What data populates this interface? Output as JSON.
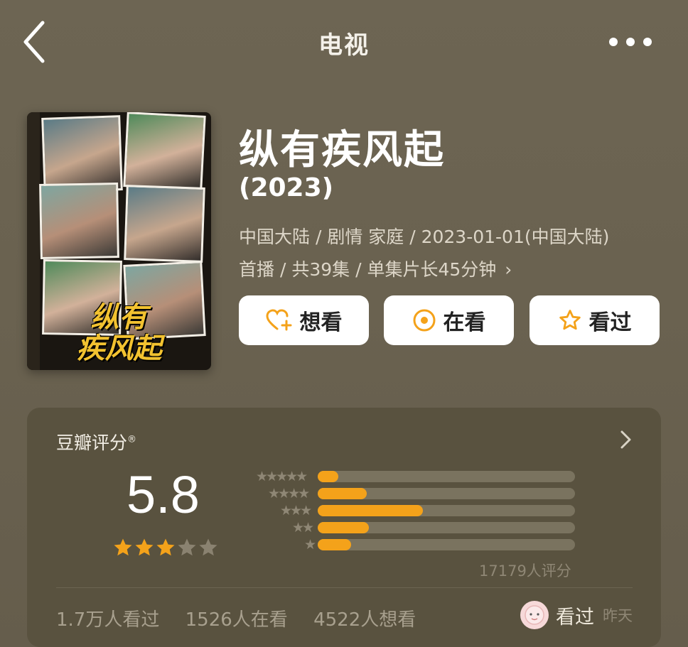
{
  "header": {
    "title": "电视",
    "back_icon": "chevron-left-icon",
    "more_icon": "more-dots-icon"
  },
  "poster": {
    "title_line1": "纵有",
    "title_line2": "疾风起"
  },
  "show": {
    "title": "纵有疾风起",
    "year": "(2023)",
    "meta_line1": "中国大陆 / 剧情 家庭 / 2023-01-01(中国大陆)",
    "meta_line2": "首播 / 共39集 / 单集片长45分钟",
    "meta_chevron": "›"
  },
  "actions": {
    "want": "想看",
    "watching": "在看",
    "watched": "看过"
  },
  "rating": {
    "label": "豆瓣评分",
    "registered_mark": "®",
    "score": "5.8",
    "stars_filled": 3,
    "stars_total": 5,
    "distribution": [
      {
        "stars": "★★★★★",
        "fraction": 0.08
      },
      {
        "stars": "★★★★",
        "fraction": 0.19
      },
      {
        "stars": "★★★",
        "fraction": 0.41
      },
      {
        "stars": "★★",
        "fraction": 0.2
      },
      {
        "stars": "★",
        "fraction": 0.13
      }
    ],
    "count": "17179人评分"
  },
  "stats": {
    "watched_count": "1.7万人看过",
    "watching_count": "1526人在看",
    "want_count": "4522人想看"
  },
  "user_status": {
    "label": "看过",
    "time": "昨天"
  },
  "colors": {
    "accent": "#f4a21a",
    "background": "#6b6352",
    "card": "#59523f"
  }
}
